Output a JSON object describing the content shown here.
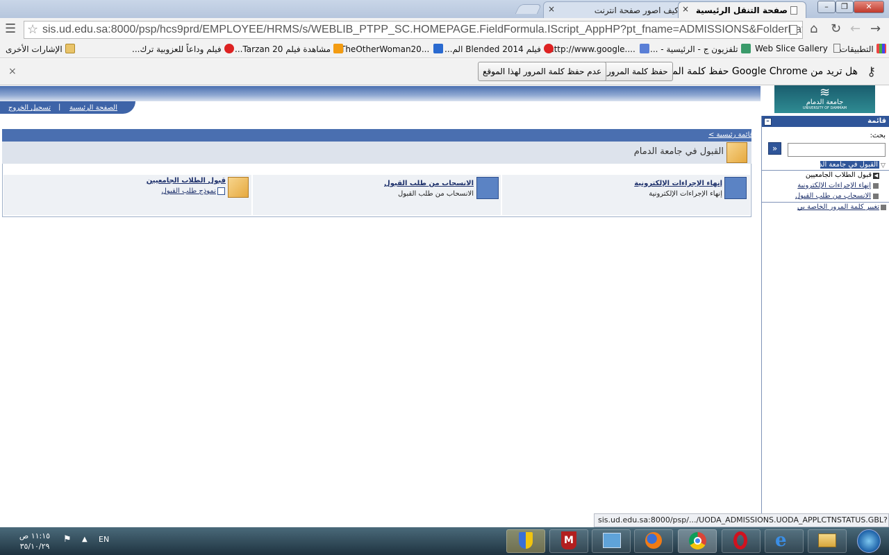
{
  "browser": {
    "tabs": [
      {
        "label": "صفحة التنقل الرئيسية",
        "active": true
      },
      {
        "label": "كيف اصور صفحة انترنت",
        "active": false
      }
    ],
    "url": "sis.ud.edu.sa:8000/psp/hcs9prd/EMPLOYEE/HRMS/s/WEBLIB_PTPP_SC.HOMEPAGE.FieldFormula.IScript_AppHP?pt_fname=ADMISSIONS&FolderPath=POI",
    "bookmarks": {
      "apps": "التطبيقات",
      "web_slice": "Web Slice Gallery",
      "b3": "تلفزيون ج - الرئيسية - ...",
      "b4": "http://www.google....",
      "b5": "فيلم Blended 2014 الم...",
      "b6": "TheOtherWoman20...",
      "b7": "مشاهدة فيلم Tarzan 20...",
      "b8": "فيلم وداعاً للعزوبية ترك...",
      "other": "الإشارات الأخرى"
    },
    "infobar": {
      "question": "هل تريد من Google Chrome حفظ كلمة المرور؟",
      "save": "حفظ كلمة المرور",
      "never": "عدم حفظ كلمة المرور لهذا الموقع",
      "close": "×"
    },
    "tab_close": "×"
  },
  "page": {
    "nav": {
      "home": "الصفحة الرئيسية",
      "sep": "|",
      "logout": "تسجيل الخروج"
    },
    "logo_text": "جامعة الدمام",
    "logo_sub": "UNIVERSITY OF DAMMAM",
    "breadcrumb": "قائمة رئيسية >",
    "title": "القبول في جامعة الدمام",
    "items": [
      {
        "link": "إنهاء الإجراءات الإلكترونية",
        "desc": "إنهاء الإجراءات الإلكترونية"
      },
      {
        "link": "الانسحاب من طلب القبول",
        "desc": "الانسحاب من طلب القبول"
      },
      {
        "link": "قبول الطلاب الجامعيين",
        "desc": "نموذج طلب القبول"
      }
    ]
  },
  "menu": {
    "header": "قائمة",
    "search_label": "بحث:",
    "search_value": "",
    "tree": {
      "root": "القبول في جامعة الدمام",
      "children": [
        "قبول الطلاب الجامعيين",
        "إنهاء الإجراءات الإلكترونية",
        "الانسحاب من طلب القبول"
      ],
      "other": "تغيير كلمة المرور الخاصة بي"
    }
  },
  "status_url": "sis.ud.edu.sa:8000/psp/.../UODA_ADMISSIONS.UODA_APPLCTNSTATUS.GBL?...",
  "taskbar": {
    "lang": "EN",
    "time": "١١:١٥ ص",
    "date": "٣٥/١٠/٢٩"
  }
}
